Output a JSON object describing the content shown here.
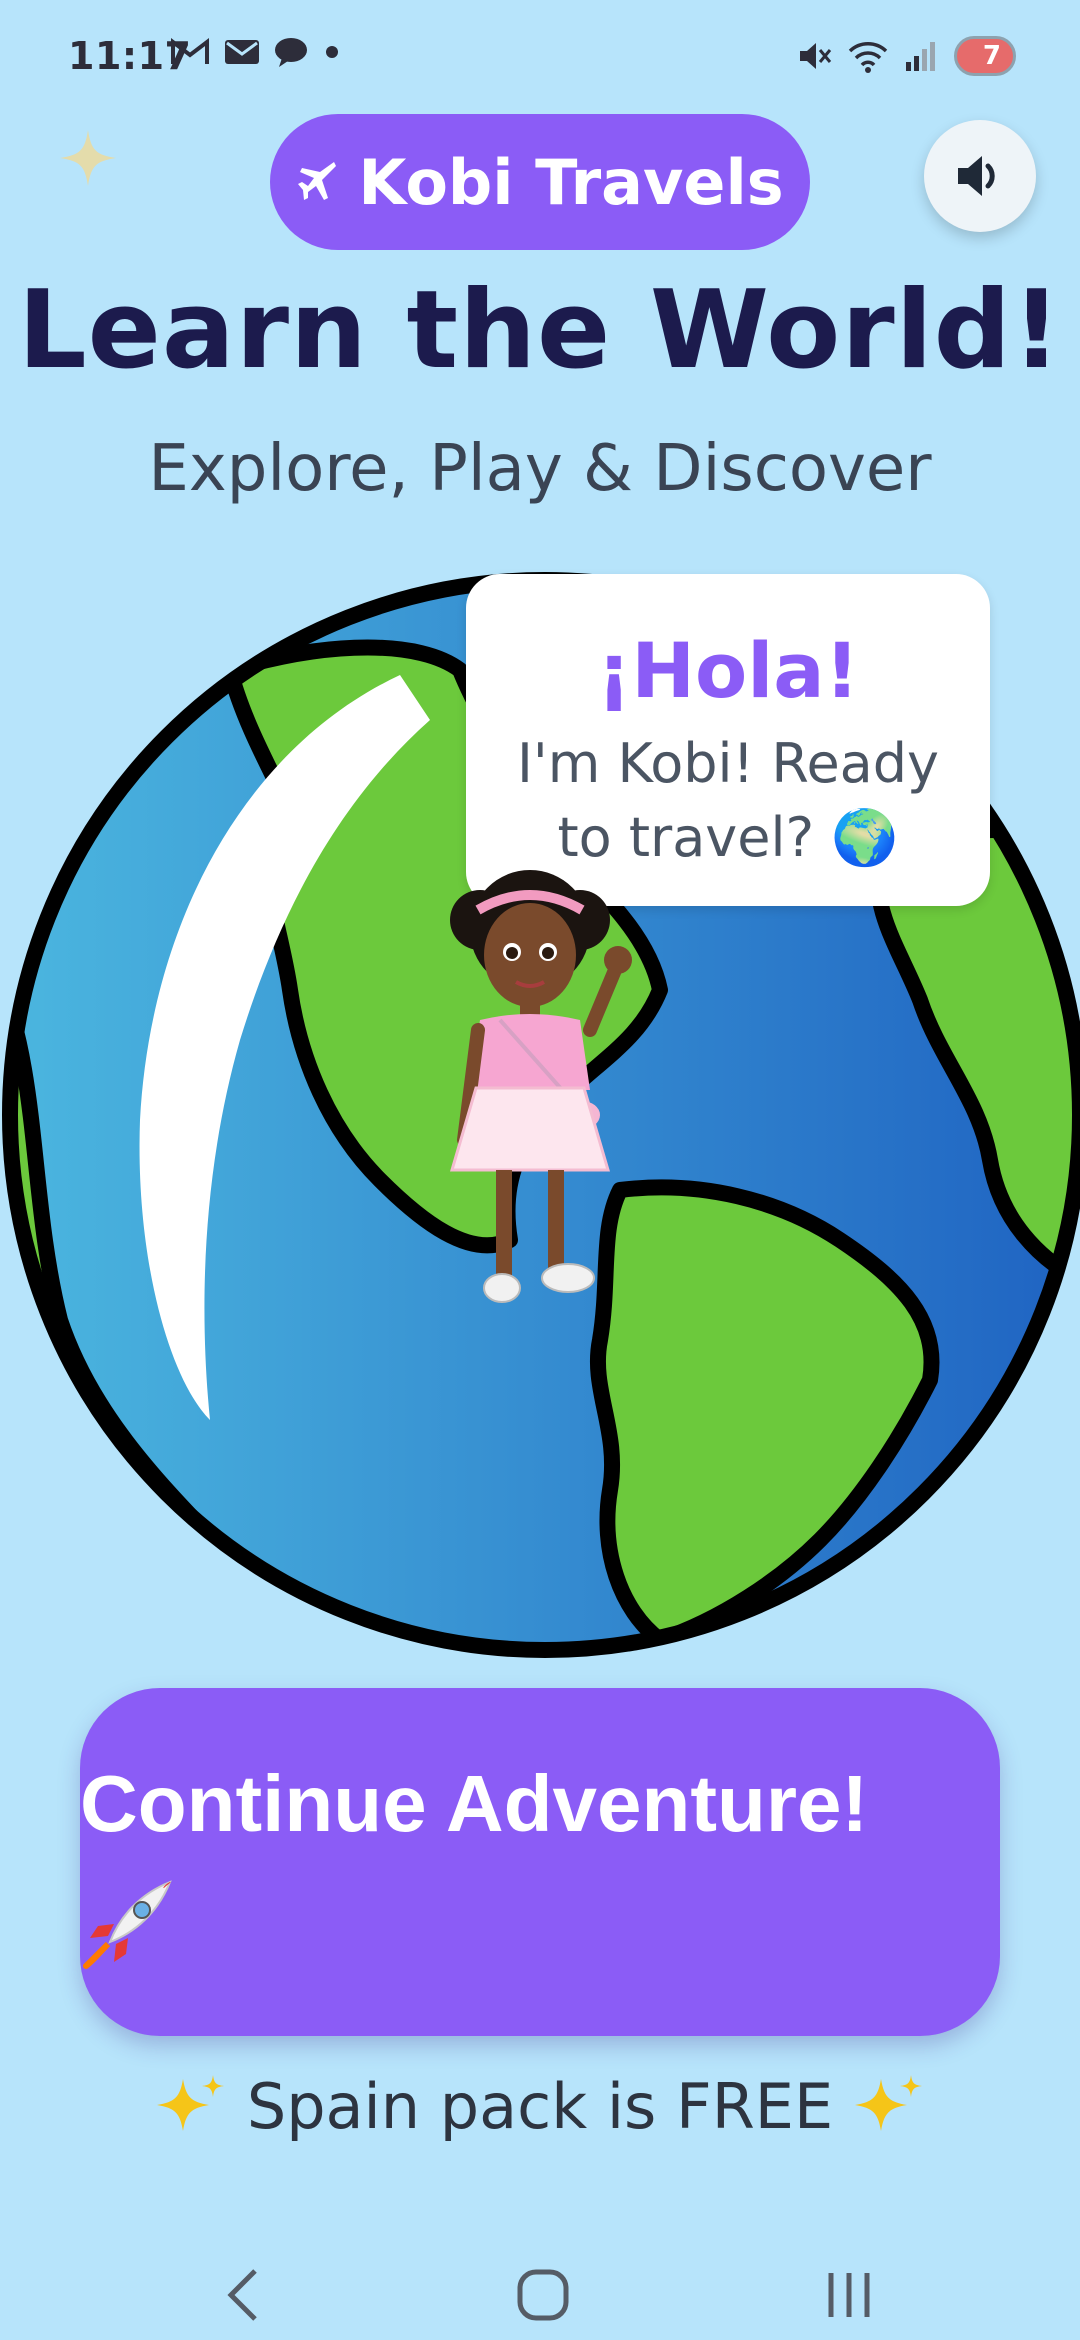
{
  "status_bar": {
    "time": "11:17",
    "battery": "7"
  },
  "header": {
    "brand_label": "Kobi Travels",
    "brand_icon": "airplane-icon",
    "sound_icon": "speaker-icon"
  },
  "hero": {
    "title": "Learn the World!",
    "subtitle": "Explore, Play & Discover"
  },
  "bubble": {
    "greeting": "¡Hola!",
    "message": "I'm Kobi! Ready to travel? 🌍"
  },
  "cta": {
    "label": "Continue Adventure!",
    "icon": "rocket-icon"
  },
  "footer": {
    "free_text": "Spain pack is FREE"
  },
  "colors": {
    "background": "#b7e4fb",
    "primary": "#8b5cf6",
    "title": "#1c1b4d",
    "ocean": "#2f7fd0",
    "land": "#6cc93c"
  }
}
